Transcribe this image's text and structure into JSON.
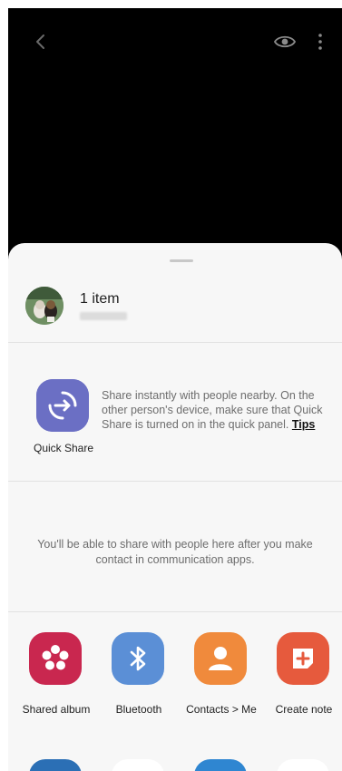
{
  "viewer": {
    "icons": [
      "back-icon",
      "eye-icon",
      "more-vert-icon"
    ]
  },
  "share_sheet": {
    "item": {
      "title": "1 item"
    },
    "quick_share": {
      "label": "Quick Share",
      "description": "Share instantly with people nearby. On the other person's device, make sure that Quick Share is turned on in the quick panel. ",
      "tips_link": "Tips",
      "icon": "quick-share-icon"
    },
    "contacts_message": "You'll be able to share with people here after you make contact in communication apps.",
    "apps": [
      {
        "label": "Shared album",
        "icon": "flower-icon",
        "color": "#c9274f"
      },
      {
        "label": "Bluetooth",
        "icon": "bluetooth-icon",
        "color": "#5b8fd6"
      },
      {
        "label": "Contacts > Me",
        "icon": "person-icon",
        "color": "#f08a3c"
      },
      {
        "label": "Create note",
        "icon": "note-add-icon",
        "color": "#e65a3d"
      }
    ],
    "more_apps_colors": [
      "#2b6fb5",
      "#ffffff",
      "#2f86d1",
      "#ffffff"
    ]
  }
}
